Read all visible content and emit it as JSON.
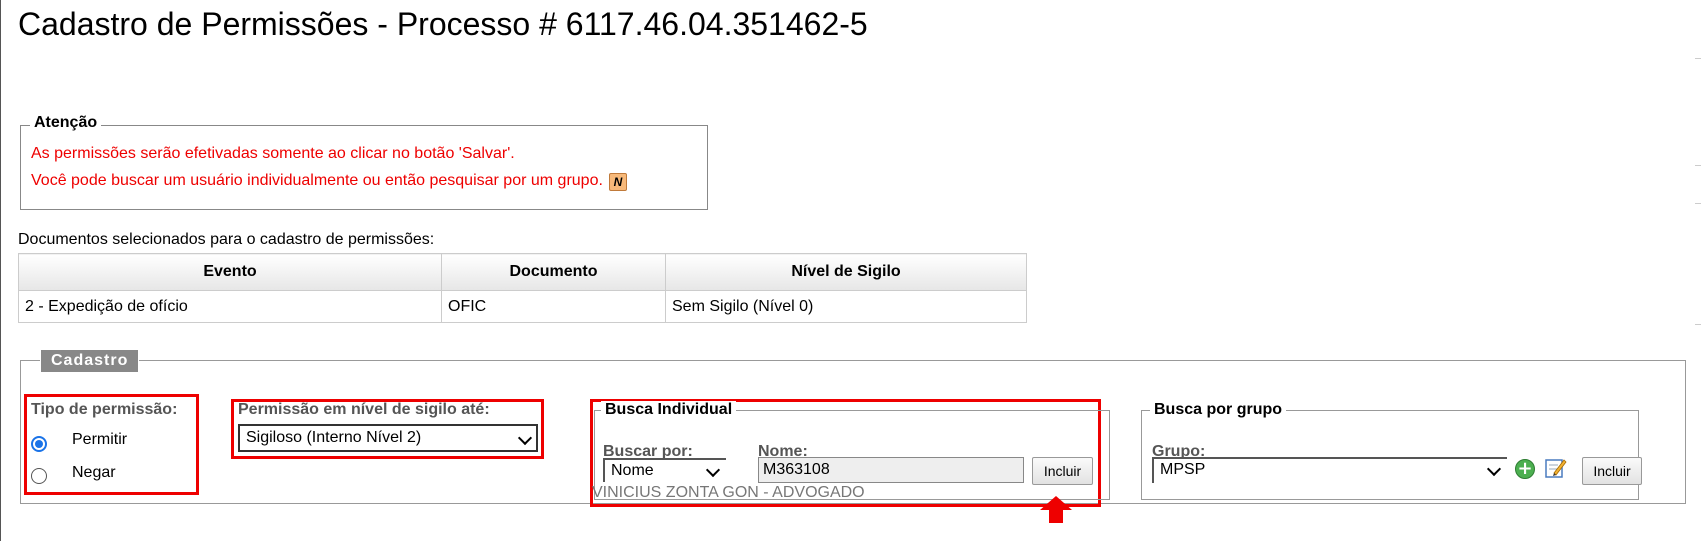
{
  "page": {
    "title": "Cadastro de Permissões - Processo # 6117.46.04.351462-5"
  },
  "attention": {
    "legend": "Atenção",
    "line1": "As permissões serão efetivadas somente ao clicar no botão 'Salvar'.",
    "line2": "Você pode buscar um usuário individualmente ou então pesquisar por um grupo.",
    "icon": "n-icon"
  },
  "documents": {
    "caption": "Documentos selecionados para o cadastro de permissões:",
    "headers": [
      "Evento",
      "Documento",
      "Nível de Sigilo"
    ],
    "rows": [
      [
        "2 - Expedição de ofício",
        "OFIC",
        "Sem Sigilo (Nível 0)"
      ]
    ]
  },
  "cadastro": {
    "legend": "Cadastro",
    "tipo_permissao": {
      "label": "Tipo de permissão:",
      "options": [
        {
          "label": "Permitir",
          "checked": true
        },
        {
          "label": "Negar",
          "checked": false
        }
      ]
    },
    "nivel_sigilo": {
      "label": "Permissão em nível de sigilo até:",
      "selected": "Sigiloso (Interno Nível 2)"
    },
    "busca_individual": {
      "legend": "Busca Individual",
      "buscar_por_label": "Buscar por:",
      "buscar_por_value": "Nome",
      "nome_label": "Nome:",
      "nome_value": "M363108",
      "button": "Incluir",
      "result": "VINICIUS ZONTA GON - ADVOGADO"
    },
    "busca_grupo": {
      "legend": "Busca por grupo",
      "grupo_label": "Grupo:",
      "grupo_value": "MPSP",
      "button": "Incluir"
    }
  },
  "colors": {
    "alert": "#e00000",
    "highlight": "#e00000",
    "radio": "#1a73e8"
  }
}
